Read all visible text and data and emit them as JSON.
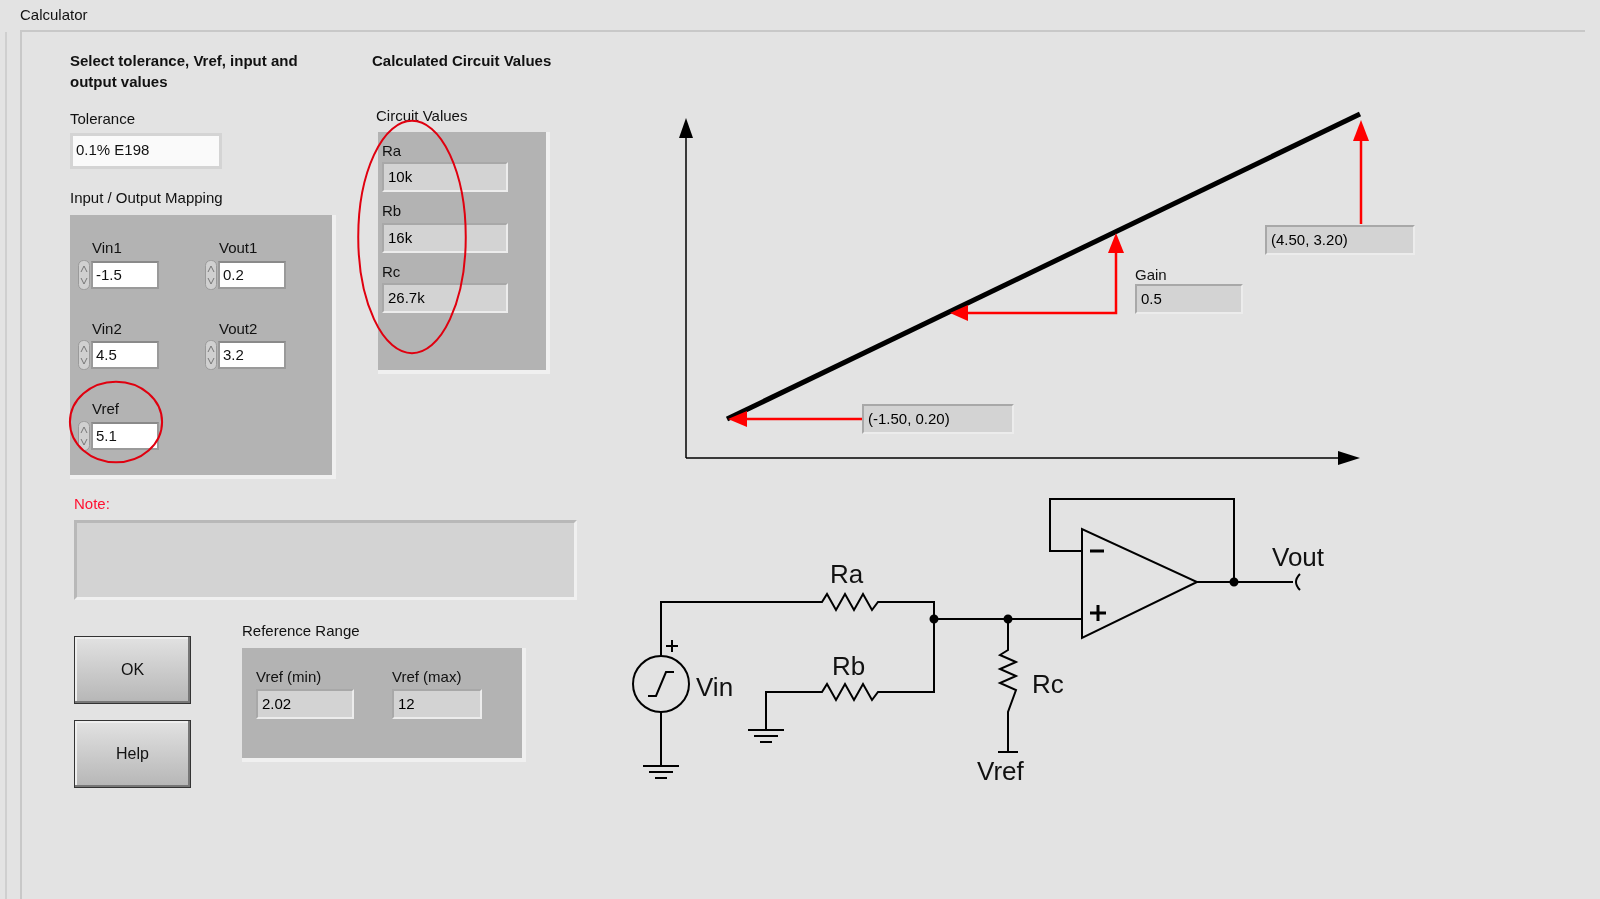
{
  "window": {
    "title": "Calculator"
  },
  "inputs_section": {
    "heading": "Select tolerance, Vref, input and output values",
    "tolerance": {
      "label": "Tolerance",
      "value": "0.1% E198"
    },
    "mapping": {
      "label": "Input / Output Mapping",
      "fields": [
        {
          "label": "Vin1",
          "value": "-1.5",
          "circled": false
        },
        {
          "label": "Vout1",
          "value": "0.2",
          "circled": false
        },
        {
          "label": "Vin2",
          "value": "4.5",
          "circled": false
        },
        {
          "label": "Vout2",
          "value": "3.2",
          "circled": false
        },
        {
          "label": "Vref",
          "value": "5.1",
          "circled": true
        }
      ]
    }
  },
  "results_section": {
    "heading": "Calculated Circuit Values",
    "group_label": "Circuit Values",
    "circled": true,
    "values": [
      {
        "label": "Ra",
        "value": "10k"
      },
      {
        "label": "Rb",
        "value": "16k"
      },
      {
        "label": "Rc",
        "value": "26.7k"
      }
    ]
  },
  "note": {
    "label": "Note:"
  },
  "buttons": [
    "OK",
    "Help"
  ],
  "reference_range": {
    "label": "Reference Range",
    "values": [
      {
        "label": "Vref (min)",
        "value": "2.02"
      },
      {
        "label": "Vref (max)",
        "value": "12"
      }
    ]
  },
  "graph": {
    "point1": "(-1.50, 0.20)",
    "gain_label": "Gain",
    "gain": "0.5",
    "point2": "(4.50, 3.20)"
  },
  "schematic": {
    "ra": "Ra",
    "rb": "Rb",
    "rc": "Rc",
    "vin": "Vin",
    "vout": "Vout",
    "vref": "Vref"
  }
}
